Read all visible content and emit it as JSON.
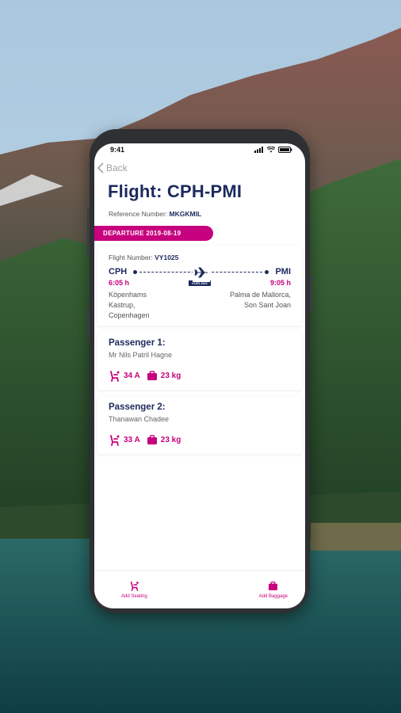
{
  "status_bar": {
    "time": "9:41"
  },
  "nav": {
    "back_label": "Back"
  },
  "header": {
    "title": "Flight: CPH-PMI",
    "reference_label": "Reference Number:",
    "reference_value": "MKGKMIL"
  },
  "departure_badge": "DEPARTURE 2019-08-19",
  "flight": {
    "number_label": "Flight Number:",
    "number_value": "VY1025",
    "from_code": "CPH",
    "to_code": "PMI",
    "dep_time": "6:05 h",
    "arr_time": "9:05 h",
    "airline_tag": "VUELING",
    "from_place": [
      "Köpenhams",
      "Kastrup,",
      "Copenhagen"
    ],
    "to_place": [
      "Palma de Mallorca,",
      "Son Sant Joan"
    ]
  },
  "passengers": [
    {
      "title": "Passenger 1:",
      "name": "Mr Nils Patril Hagne",
      "seat": "34 A",
      "baggage": "23 kg"
    },
    {
      "title": "Passenger 2:",
      "name": "Thanawan Chadee",
      "seat": "33 A",
      "baggage": "23 kg"
    }
  ],
  "bottom_bar": {
    "seating_label": "Add Seating",
    "baggage_label": "Add Baggage"
  },
  "colors": {
    "accent": "#c6007e",
    "navy": "#1c2a5e"
  }
}
